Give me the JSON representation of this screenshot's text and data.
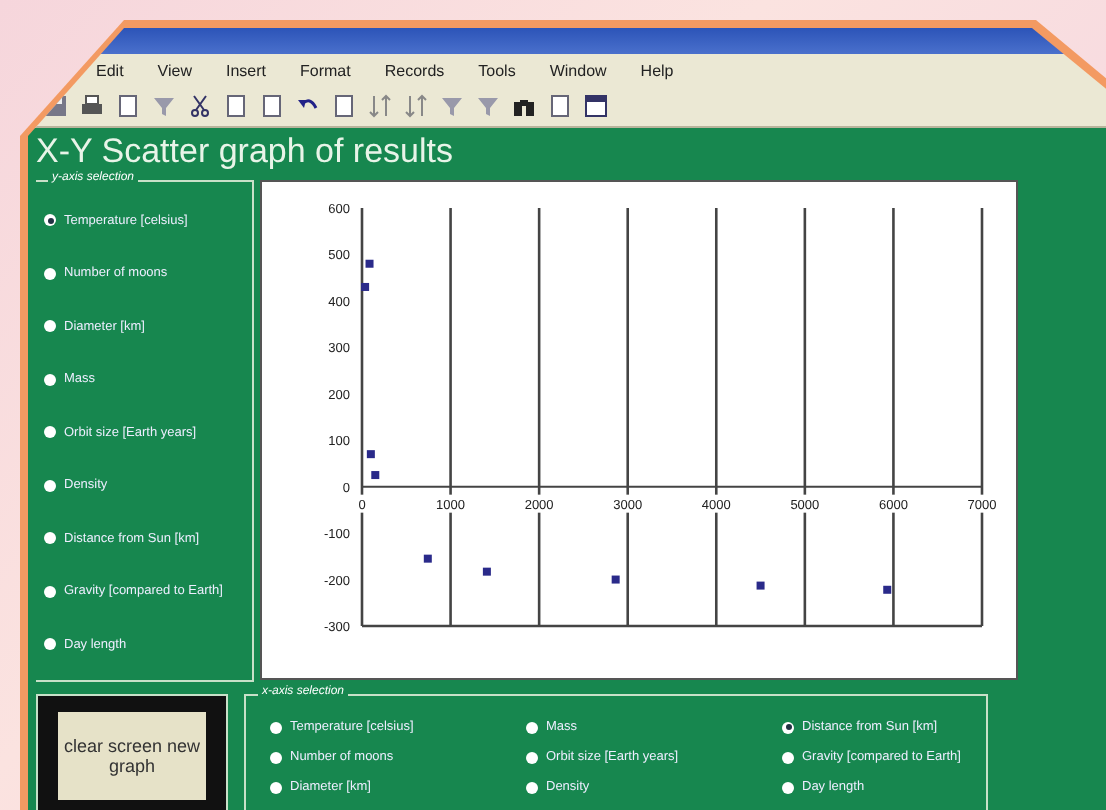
{
  "menu_bar": {
    "items": [
      "Edit",
      "View",
      "Insert",
      "Format",
      "Records",
      "Tools",
      "Window",
      "Help"
    ]
  },
  "form": {
    "title": "X-Y Scatter graph of results",
    "y_axis_selection": {
      "label": "y-axis selection",
      "options": [
        {
          "label": "Temperature [celsius]",
          "selected": true
        },
        {
          "label": "Number of moons",
          "selected": false
        },
        {
          "label": "Diameter [km]",
          "selected": false
        },
        {
          "label": "Mass",
          "selected": false
        },
        {
          "label": "Orbit size [Earth years]",
          "selected": false
        },
        {
          "label": "Density",
          "selected": false
        },
        {
          "label": "Distance from Sun [km]",
          "selected": false
        },
        {
          "label": "Gravity [compared to Earth]",
          "selected": false
        },
        {
          "label": "Day length",
          "selected": false
        }
      ]
    },
    "chart": {
      "chart_data": {
        "type": "scatter",
        "x": [
          35,
          85,
          100,
          150,
          743,
          1410,
          2864,
          4500,
          5930
        ],
        "series": [
          {
            "color": "#2a2a8a",
            "values": [
              430,
              480,
              70,
              25,
              -155,
              -183,
              -200,
              -213,
              -222
            ]
          }
        ],
        "grid": true,
        "xlim": [
          0,
          7000
        ],
        "ylim": [
          -300,
          600
        ],
        "xticks": [
          0,
          1000,
          2000,
          3000,
          4000,
          5000,
          6000,
          7000
        ],
        "yticks": [
          -300,
          -200,
          -100,
          0,
          100,
          200,
          300,
          400,
          500,
          600
        ]
      }
    },
    "button": "clear screen new graph",
    "x_axis_selection": {
      "label": "x-axis selection",
      "options": [
        {
          "label": "Temperature [celsius]",
          "selected": false
        },
        {
          "label": "Number of moons",
          "selected": false
        },
        {
          "label": "Diameter [km]",
          "selected": false
        },
        {
          "label": "Mass",
          "selected": false
        },
        {
          "label": "Orbit size [Earth years]",
          "selected": false
        },
        {
          "label": "Density",
          "selected": false
        },
        {
          "label": "Distance from Sun [km]",
          "selected": true
        },
        {
          "label": "Gravity [compared to Earth]",
          "selected": false
        },
        {
          "label": "Day length",
          "selected": false
        }
      ]
    }
  }
}
